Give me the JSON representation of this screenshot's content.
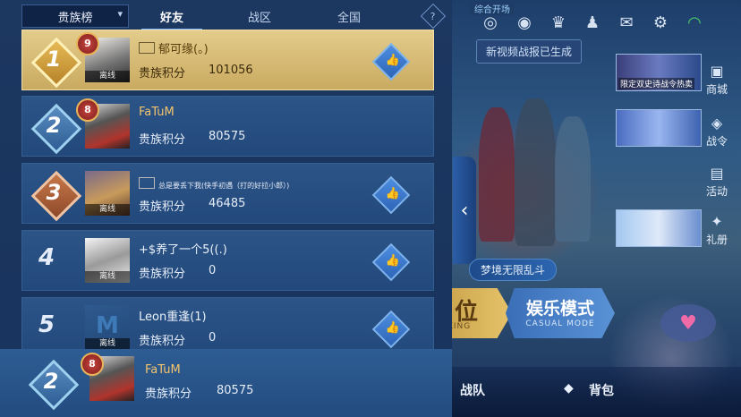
{
  "leaderboard": {
    "dropdown_label": "贵族榜",
    "tabs": [
      "好友",
      "战区",
      "全国"
    ],
    "score_label": "贵族积分",
    "offline_label": "离线",
    "rows": [
      {
        "rank": "1",
        "vip": "9",
        "name": "郁可缘(。)",
        "score": "101056",
        "offline": true
      },
      {
        "rank": "2",
        "vip": "8",
        "name": "FaTuM",
        "score": "80575",
        "offline": false
      },
      {
        "rank": "3",
        "vip": "",
        "name": "总是要丢下我(快手初遇（打的好拉小郎）)",
        "score": "46485",
        "offline": true
      },
      {
        "rank": "4",
        "vip": "",
        "name": "+$养了一个5((.)",
        "score": "0",
        "offline": true
      },
      {
        "rank": "5",
        "vip": "",
        "name": "Leon重逢(1)",
        "score": "0",
        "offline": true
      }
    ],
    "self": {
      "rank": "2",
      "vip": "8",
      "name": "FaTuM",
      "score": "80575"
    }
  },
  "game": {
    "top_tag": "综合开场",
    "new_video_notice": "新视频战报已生成",
    "side_cards": [
      {
        "caption": "限定双史诗战令热卖"
      },
      {
        "caption": ""
      },
      {
        "caption": ""
      }
    ],
    "side_buttons": [
      "商城",
      "战令",
      "活动",
      "礼册"
    ],
    "dream_mode": "梦境无限乱斗",
    "rank_mode": {
      "big": "位",
      "small": "KING"
    },
    "fun_mode": {
      "big": "娱乐模式",
      "small": "CASUAL MODE"
    },
    "bottom": {
      "team": "战队",
      "bag": "背包"
    }
  }
}
